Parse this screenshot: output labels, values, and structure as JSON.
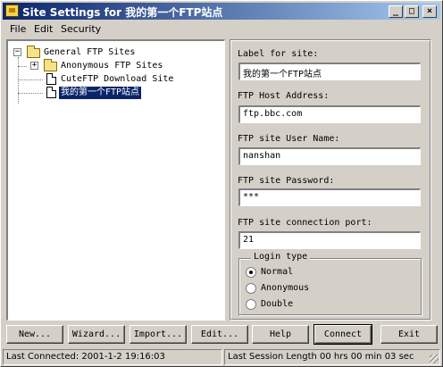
{
  "window": {
    "title": "Site Settings for 我的第一个FTP站点",
    "controls": {
      "minimize": "_",
      "maximize": "□",
      "close": "×"
    }
  },
  "menu": {
    "items": [
      {
        "label": "File"
      },
      {
        "label": "Edit"
      },
      {
        "label": "Security"
      }
    ]
  },
  "tree": {
    "root": {
      "label": "General FTP Sites",
      "expander": "−",
      "icon": "folder-icon"
    },
    "children": [
      {
        "label": "Anonymous FTP Sites",
        "expander": "+",
        "icon": "folder-icon"
      },
      {
        "label": "CuteFTP Download Site",
        "icon": "document-icon"
      },
      {
        "label": "我的第一个FTP站点",
        "icon": "document-icon",
        "selected": true
      }
    ]
  },
  "form": {
    "site_label": {
      "label": "Label for site:",
      "value": "我的第一个FTP站点"
    },
    "host": {
      "label": "FTP Host Address:",
      "value": "ftp.bbc.com"
    },
    "user": {
      "label": "FTP site User Name:",
      "value": "nanshan"
    },
    "password": {
      "label": "FTP site Password:",
      "value": "***"
    },
    "port": {
      "label": "FTP site connection port:",
      "value": "21"
    },
    "login_type": {
      "title": "Login type",
      "options": [
        {
          "label": "Normal",
          "checked": true
        },
        {
          "label": "Anonymous",
          "checked": false
        },
        {
          "label": "Double",
          "checked": false
        }
      ]
    }
  },
  "buttons": {
    "new": "New...",
    "wizard": "Wizard...",
    "import": "Import...",
    "edit": "Edit...",
    "help": "Help",
    "connect": "Connect",
    "exit": "Exit"
  },
  "status": {
    "last_connected": "Last Connected: 2001-1-2 19:16:03",
    "last_session": "Last Session Length 00 hrs 00 min 03 sec"
  },
  "colors": {
    "title_bar": "#0a246a",
    "face": "#d4d0c8",
    "selection": "#0a246a"
  }
}
